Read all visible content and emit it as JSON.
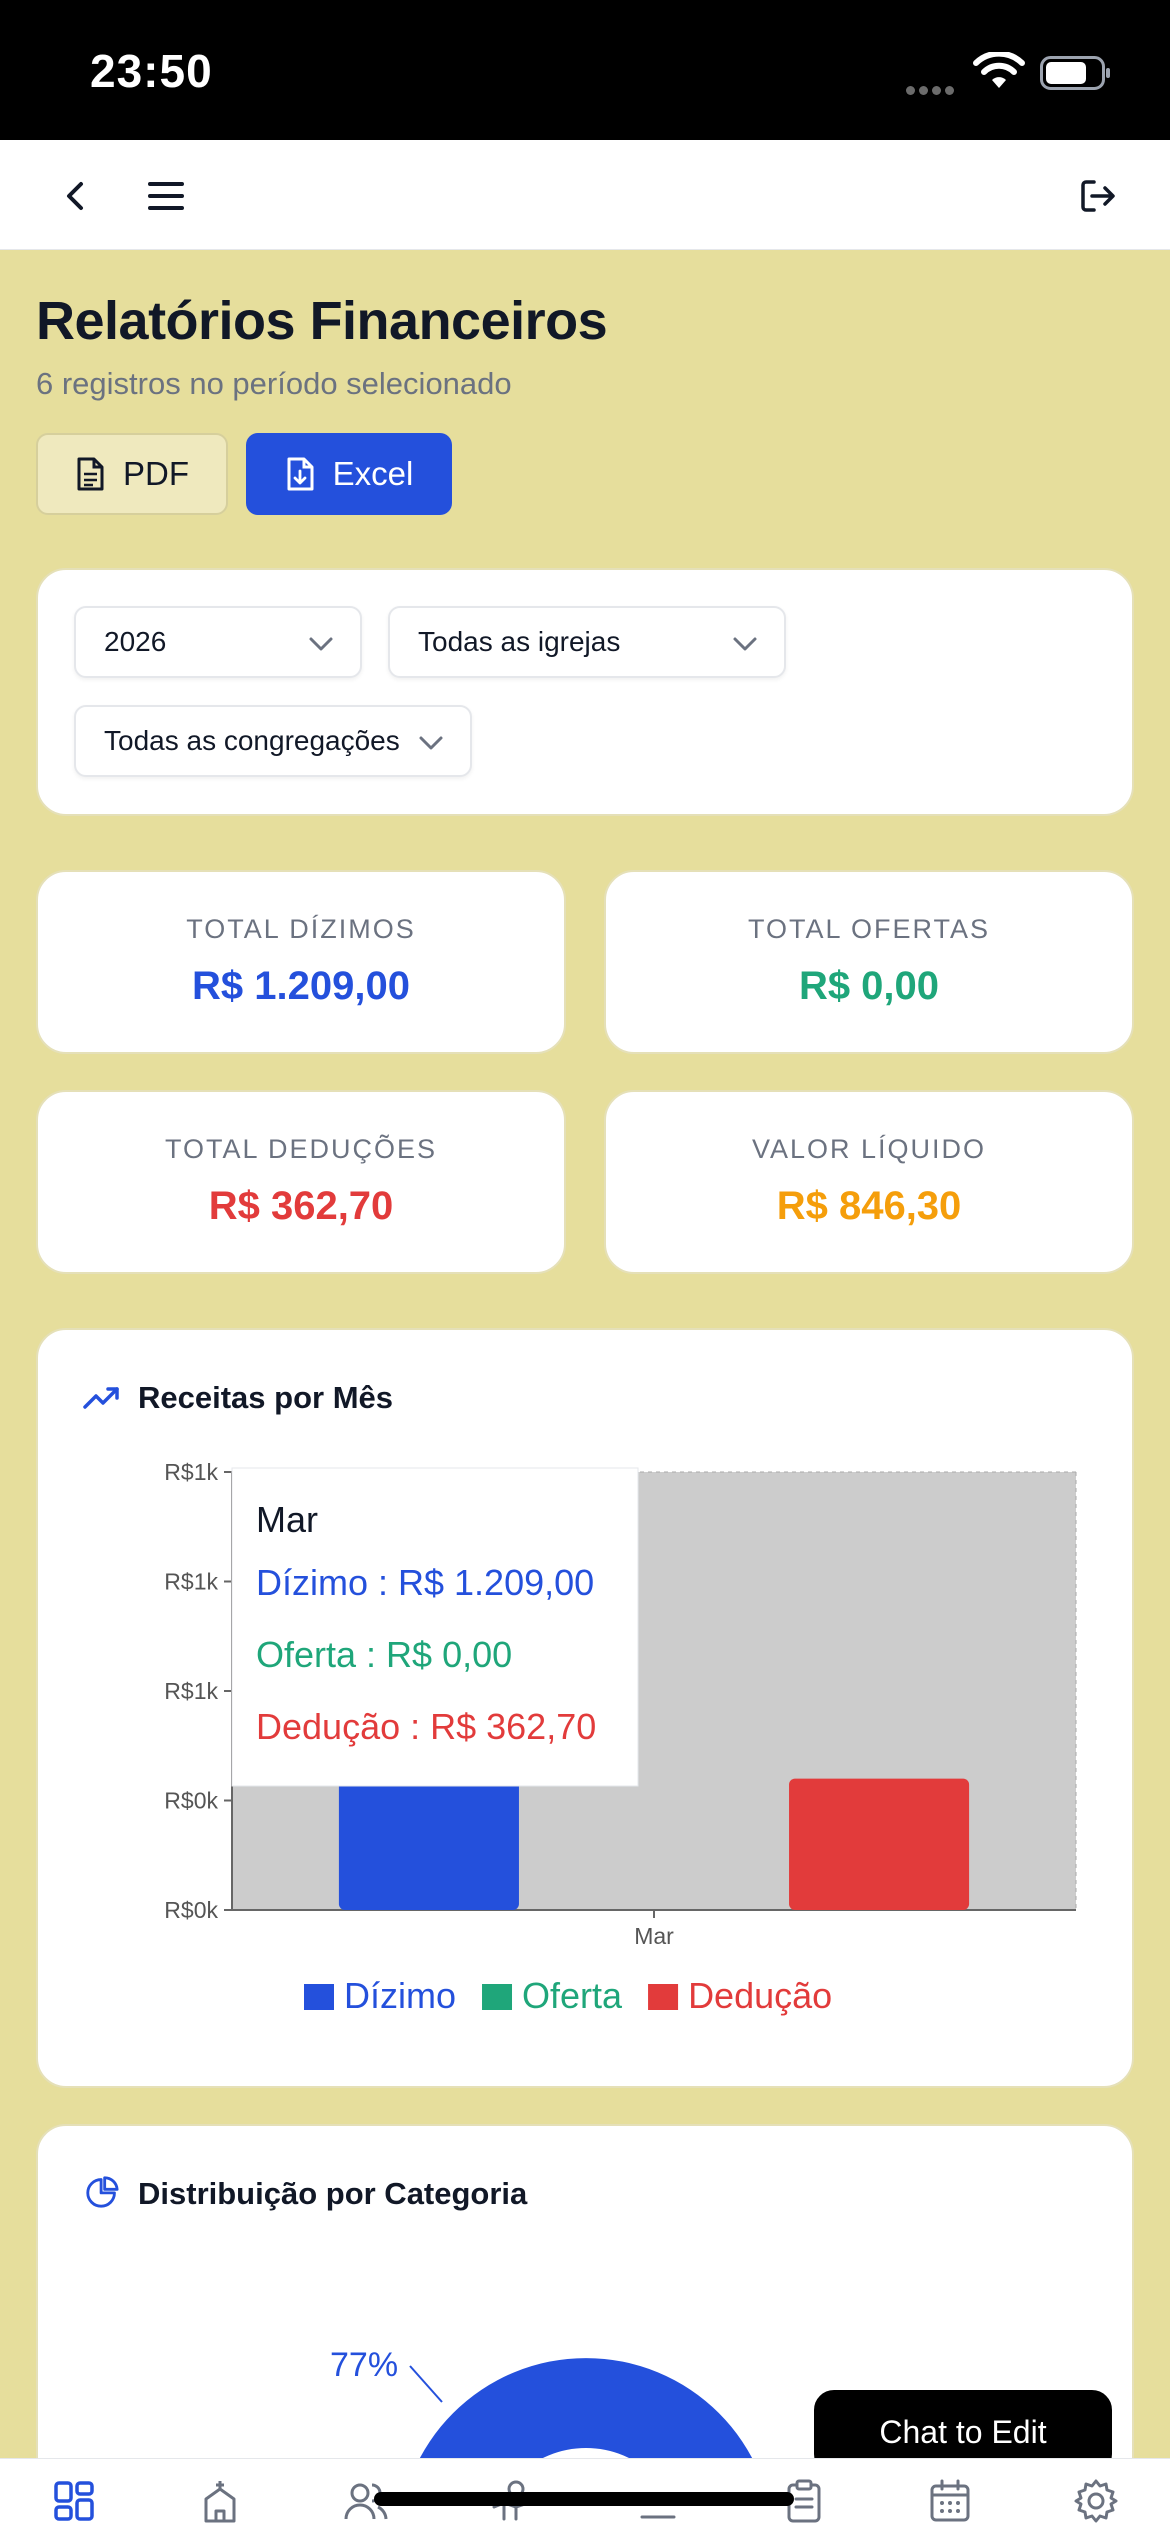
{
  "status_bar": {
    "time": "23:50"
  },
  "header": {
    "title": "Relatórios Financeiros",
    "subtitle": "6 registros no período selecionado",
    "pdf_label": "PDF",
    "excel_label": "Excel"
  },
  "filters": {
    "year": "2026",
    "church": "Todas as igrejas",
    "congregation": "Todas as congregações"
  },
  "stats": [
    {
      "label": "TOTAL DÍZIMOS",
      "value": "R$ 1.209,00",
      "color": "#2450DC"
    },
    {
      "label": "TOTAL OFERTAS",
      "value": "R$ 0,00",
      "color": "#1FA67A"
    },
    {
      "label": "TOTAL DEDUÇÕES",
      "value": "R$ 362,70",
      "color": "#E23B3B"
    },
    {
      "label": "VALOR LÍQUIDO",
      "value": "R$ 846,30",
      "color": "#F59E0B"
    }
  ],
  "revenue_chart": {
    "title": "Receitas por Mês",
    "tooltip": {
      "title": "Mar",
      "lines": [
        "Dízimo : R$ 1.209,00",
        "Oferta : R$ 0,00",
        "Dedução : R$ 362,70"
      ]
    }
  },
  "distribution_chart": {
    "title": "Distribuição por Categoria",
    "label": "77%"
  },
  "chat_button": "Chat to Edit",
  "chart_data": [
    {
      "type": "bar",
      "title": "Receitas por Mês",
      "categories": [
        "Mar"
      ],
      "series": [
        {
          "name": "Dízimo",
          "values": [
            1209.0
          ],
          "color": "#2450DC"
        },
        {
          "name": "Oferta",
          "values": [
            0.0
          ],
          "color": "#1FA67A"
        },
        {
          "name": "Dedução",
          "values": [
            362.7
          ],
          "color": "#E23B3B"
        }
      ],
      "y_tick_labels": [
        "R$0k",
        "R$0k",
        "R$1k",
        "R$1k",
        "R$1k"
      ],
      "ylim": [
        0,
        1209
      ],
      "legend": "bottom",
      "grid": false
    },
    {
      "type": "pie",
      "title": "Distribuição por Categoria",
      "slices": [
        {
          "label": "77%",
          "value": 77,
          "color": "#2450DC"
        }
      ]
    }
  ]
}
